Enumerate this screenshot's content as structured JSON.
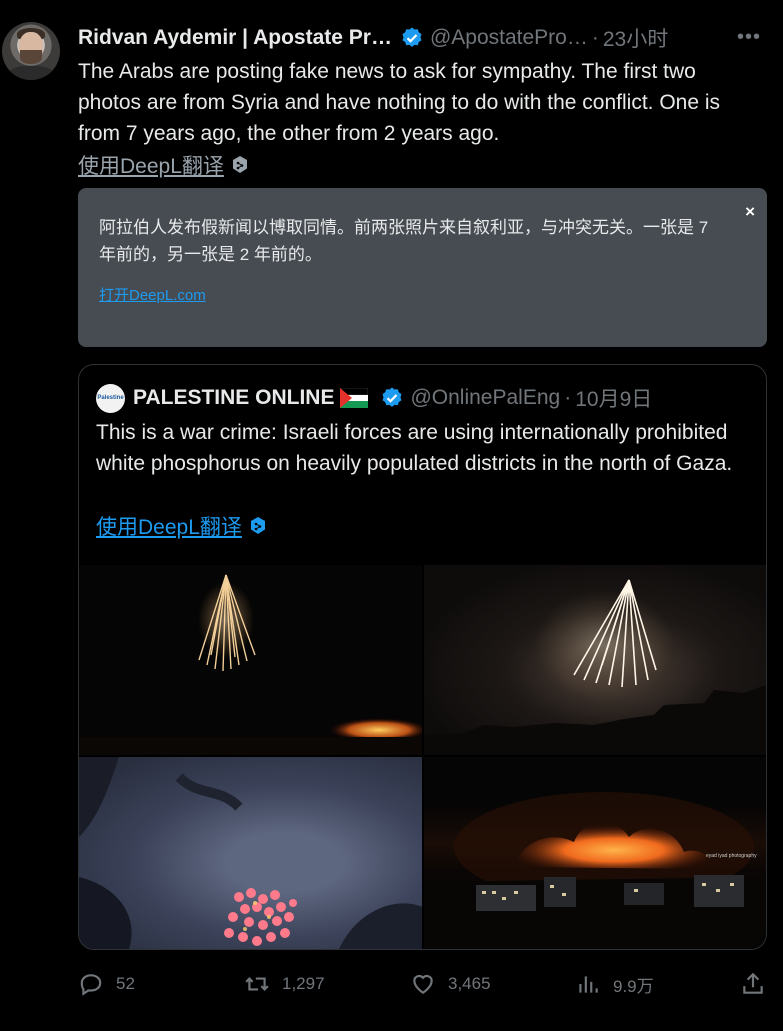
{
  "tweet": {
    "author_name": "Ridvan Aydemir | Apostate Pr…",
    "handle": "@ApostatePro…",
    "separator": "·",
    "time": "23小时",
    "more": "•••",
    "text": "The Arabs are posting fake news to ask for sympathy. The first two photos are from Syria and have nothing to do with the conflict. One is from 7 years ago, the other from 2 years ago.",
    "translate_link": "使用DeepL翻译"
  },
  "translation": {
    "text": "阿拉伯人发布假新闻以博取同情。前两张照片来自叙利亚，与冲突无关。一张是 7 年前的，另一张是 2 年前的。",
    "link": "打开DeepL.com",
    "close": "×"
  },
  "quoted": {
    "avatar_text": "Palestine",
    "author_name": "PALESTINE ONLINE",
    "handle": "@OnlinePalEng",
    "separator": "·",
    "date": "10月9日",
    "text": "This is a war crime: Israeli forces are using internationally prohibited white phosphorus on heavily populated districts in the north of Gaza.",
    "translate_link": "使用DeepL翻译",
    "photo_watermark": "eyad iyad photography"
  },
  "actions": {
    "reply_count": "52",
    "retweet_count": "1,297",
    "like_count": "3,465",
    "views_count": "9.9万"
  },
  "colors": {
    "background": "#000000",
    "text": "#e7e9ea",
    "secondary": "#71767b",
    "accent": "#1d9bf0",
    "translation_box": "#464c52"
  },
  "icons": [
    "verified-badge-icon",
    "more-icon",
    "deepl-icon",
    "palestine-flag-icon",
    "reply-icon",
    "retweet-icon",
    "like-icon",
    "views-icon",
    "share-icon"
  ]
}
